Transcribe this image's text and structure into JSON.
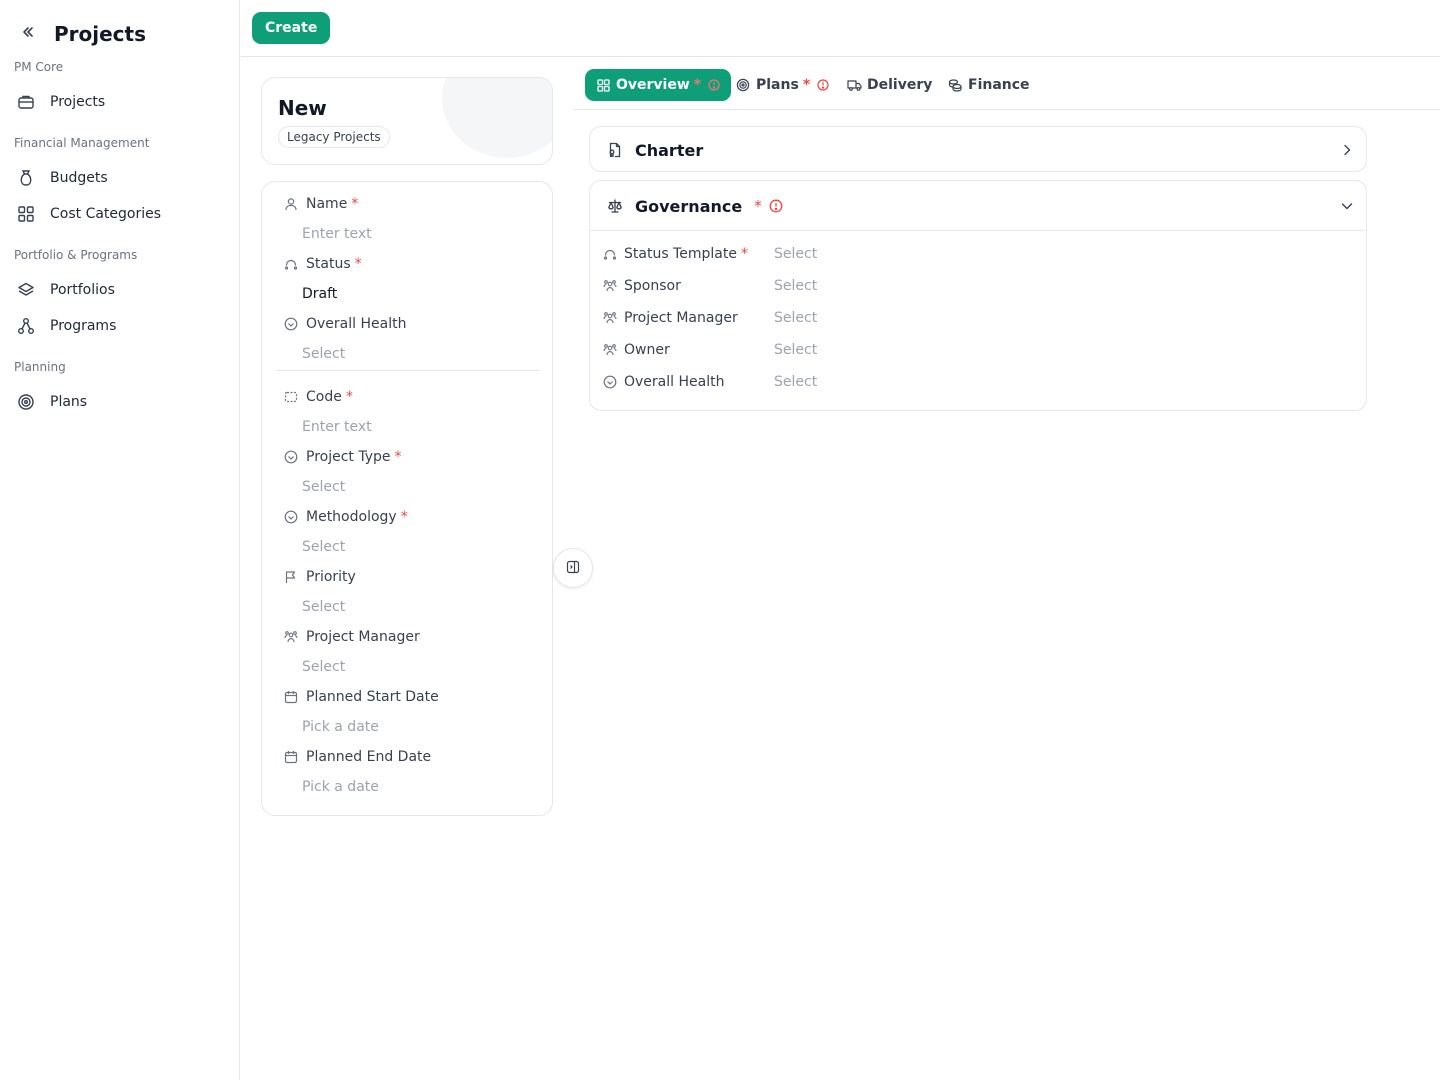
{
  "sidebar": {
    "title": "Projects",
    "groups": [
      {
        "label": "PM Core",
        "items": [
          {
            "label": "Projects",
            "icon": "briefcase-icon"
          }
        ]
      },
      {
        "label": "Financial Management",
        "items": [
          {
            "label": "Budgets",
            "icon": "money-bag-icon"
          },
          {
            "label": "Cost Categories",
            "icon": "grid-icon"
          }
        ]
      },
      {
        "label": "Portfolio & Programs",
        "items": [
          {
            "label": "Portfolios",
            "icon": "layers-icon"
          },
          {
            "label": "Programs",
            "icon": "network-icon"
          }
        ]
      },
      {
        "label": "Planning",
        "items": [
          {
            "label": "Plans",
            "icon": "target-icon"
          }
        ]
      }
    ]
  },
  "toolbar": {
    "create_label": "Create"
  },
  "record": {
    "title": "New",
    "badge": "Legacy Projects"
  },
  "form": {
    "fields": [
      {
        "label": "Name",
        "required": true,
        "value": "Enter text",
        "icon": "user-icon"
      },
      {
        "label": "Status",
        "required": true,
        "value": "Draft",
        "icon": "status-icon"
      },
      {
        "label": "Overall Health",
        "required": false,
        "value": "Select",
        "icon": "circle-check-icon"
      },
      {
        "label": "Code",
        "required": true,
        "value": "Enter text",
        "icon": "scan-icon"
      },
      {
        "label": "Project Type",
        "required": true,
        "value": "Select",
        "icon": "circle-check-icon"
      },
      {
        "label": "Methodology",
        "required": true,
        "value": "Select",
        "icon": "circle-check-icon"
      },
      {
        "label": "Priority",
        "required": false,
        "value": "Select",
        "icon": "flag-icon"
      },
      {
        "label": "Project Manager",
        "required": false,
        "value": "Select",
        "icon": "users-icon"
      },
      {
        "label": "Planned Start Date",
        "required": false,
        "value": "Pick a date",
        "icon": "calendar-icon"
      },
      {
        "label": "Planned End Date",
        "required": false,
        "value": "Pick a date",
        "icon": "calendar-icon"
      }
    ],
    "required_mark": "*"
  },
  "tabs": [
    {
      "label": "Overview",
      "required_mark": "*",
      "icon": "dashboard-icon",
      "active": true
    },
    {
      "label": "Plans",
      "required_mark": "*",
      "icon": "target-icon",
      "active": false
    },
    {
      "label": "Delivery",
      "icon": "truck-icon",
      "active": false
    },
    {
      "label": "Finance",
      "icon": "coins-icon",
      "active": false
    }
  ],
  "sections": {
    "charter": {
      "title": "Charter"
    },
    "governance": {
      "title": "Governance",
      "required_mark": "*",
      "rows": [
        {
          "label": "Status Template",
          "required": true,
          "value": "Select",
          "icon": "status-icon"
        },
        {
          "label": "Sponsor",
          "required": false,
          "value": "Select",
          "icon": "users-icon"
        },
        {
          "label": "Project Manager",
          "required": false,
          "value": "Select",
          "icon": "users-icon"
        },
        {
          "label": "Owner",
          "required": false,
          "value": "Select",
          "icon": "users-icon"
        },
        {
          "label": "Overall Health",
          "required": false,
          "value": "Select",
          "icon": "circle-check-icon"
        }
      ]
    }
  },
  "colors": {
    "accent": "#0f9f78",
    "required": "#ef4444",
    "placeholder": "#9ca3af"
  }
}
